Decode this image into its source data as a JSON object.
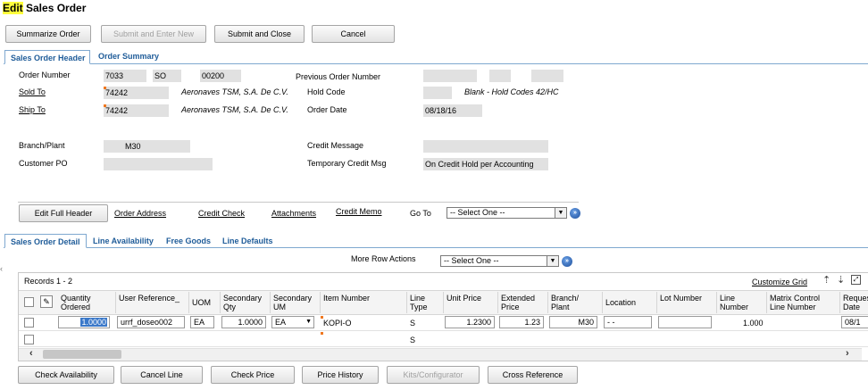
{
  "title": {
    "highlight": "Edit",
    "rest": " Sales Order"
  },
  "toolbar": {
    "summarize": "Summarize Order",
    "submit_enter_new": "Submit and Enter New",
    "submit_close": "Submit and Close",
    "cancel": "Cancel"
  },
  "header_tabs": {
    "tab1": "Sales Order Header",
    "tab2": "Order Summary"
  },
  "header": {
    "order_number_label": "Order Number",
    "order_number": "7033",
    "order_type": "SO",
    "order_company": "00200",
    "prev_order_label": "Previous Order Number",
    "sold_to_label": "Sold To",
    "sold_to": "74242",
    "sold_to_name": "Aeronaves TSM, S.A. De C.V.",
    "hold_code_label": "Hold Code",
    "hold_code_desc": "Blank - Hold Codes 42/HC",
    "ship_to_label": "Ship To",
    "ship_to": "74242",
    "ship_to_name": "Aeronaves TSM, S.A. De C.V.",
    "order_date_label": "Order Date",
    "order_date": "08/18/16",
    "branch_label": "Branch/Plant",
    "branch": "M30",
    "credit_msg_label": "Credit Message",
    "customer_po_label": "Customer PO",
    "temp_credit_label": "Temporary Credit Msg",
    "temp_credit": "On Credit Hold per Accounting"
  },
  "header_actions": {
    "edit_full_header": "Edit Full Header",
    "order_address": "Order Address",
    "credit_check": "Credit Check",
    "attachments": "Attachments",
    "credit_memo": "Credit Memo",
    "go_to_label": "Go To",
    "go_to_select": "-- Select One --"
  },
  "detail_tabs": {
    "tab1": "Sales Order Detail",
    "tab2": "Line Availability",
    "tab3": "Free Goods",
    "tab4": "Line Defaults"
  },
  "row_actions": {
    "label": "More Row Actions",
    "select": "-- Select One --"
  },
  "grid": {
    "records": "Records 1 - 2",
    "customize": "Customize Grid",
    "columns": {
      "qty": "Quantity Ordered",
      "userref": "User Reference_",
      "uom": "UOM",
      "secqty": "Secondary Qty",
      "secuom": "Secondary UM",
      "item": "Item Number",
      "linetype": "Line Type",
      "unitprice": "Unit Price",
      "extprice": "Extended Price",
      "branch": "Branch/ Plant",
      "location": "Location",
      "lot": "Lot Number",
      "linenum": "Line Number",
      "matrix": "Matrix Control Line Number",
      "reqdate": "Requested Date"
    },
    "row1": {
      "qty": "1.0000",
      "userref": "urrf_doseo002",
      "uom": "EA",
      "secqty": "1.0000",
      "secuom": "EA",
      "item": "KOPI-O",
      "linetype": "S",
      "unitprice": "1.2300",
      "extprice": "1.23",
      "branch": "M30",
      "location": " -  - ",
      "lot": "",
      "linenum": "1.000",
      "reqdate": "08/1"
    },
    "row2": {
      "linetype": "S"
    }
  },
  "bottom_buttons": {
    "check_availability": "Check Availability",
    "cancel_line": "Cancel Line",
    "check_price": "Check Price",
    "price_history": "Price History",
    "kits": "Kits/Configurator",
    "cross_reference": "Cross Reference"
  }
}
